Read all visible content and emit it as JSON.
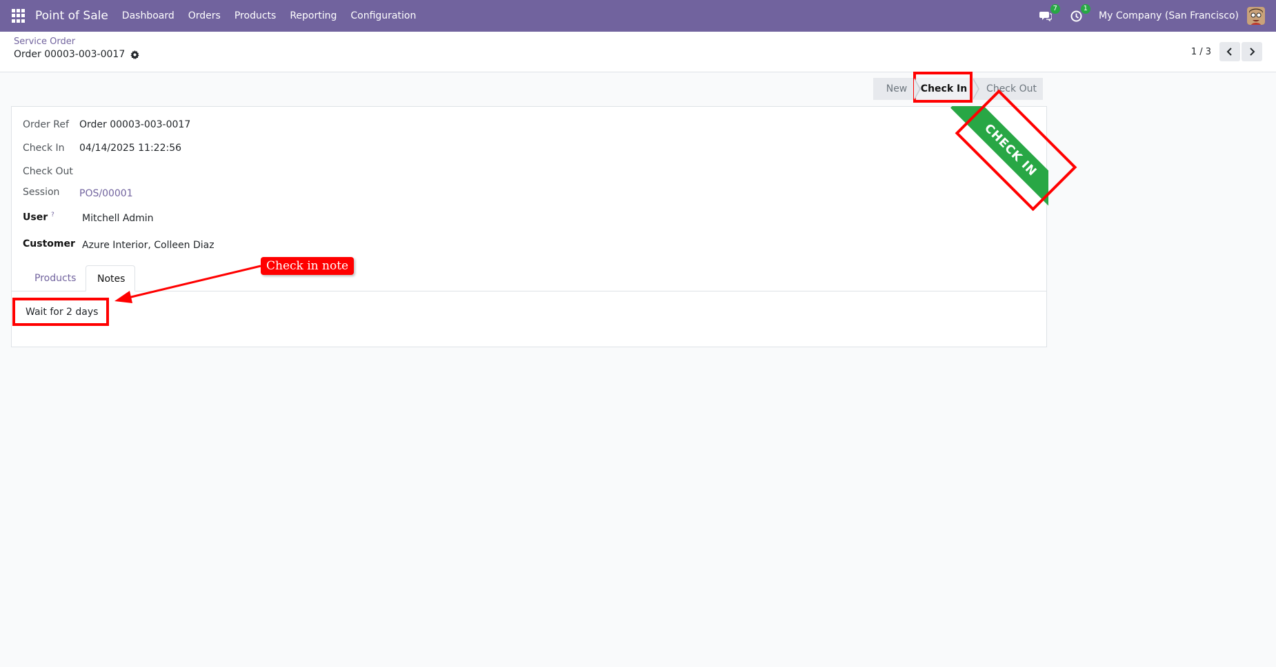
{
  "navbar": {
    "app_name": "Point of Sale",
    "menu": [
      "Dashboard",
      "Orders",
      "Products",
      "Reporting",
      "Configuration"
    ],
    "messages_count": "7",
    "activities_count": "1",
    "company": "My Company (San Francisco)"
  },
  "control_panel": {
    "breadcrumb": "Service Order",
    "record_title": "Order 00003-003-0017",
    "pager": "1 / 3"
  },
  "statusbar": {
    "stages": [
      "New",
      "Check In",
      "Check Out"
    ],
    "active": "Check In"
  },
  "form": {
    "order_ref_label": "Order Ref",
    "order_ref_value": "Order 00003-003-0017",
    "check_in_label": "Check In",
    "check_in_value": "04/14/2025 11:22:56",
    "check_out_label": "Check Out",
    "check_out_value": "",
    "session_label": "Session",
    "session_value": "POS/00001",
    "user_label": "User",
    "user_help": "?",
    "user_value": "Mitchell Admin",
    "customer_label": "Customer",
    "customer_value": "Azure Interior, Colleen Diaz",
    "tabs": [
      "Products",
      "Notes"
    ],
    "active_tab": "Notes",
    "note": "Wait for 2 days"
  },
  "ribbon": {
    "text": "CHECK IN",
    "color": "#28a745"
  },
  "annotation": {
    "label": "Check in note",
    "color": "#ff0000"
  },
  "colors": {
    "brand": "#71639e"
  }
}
